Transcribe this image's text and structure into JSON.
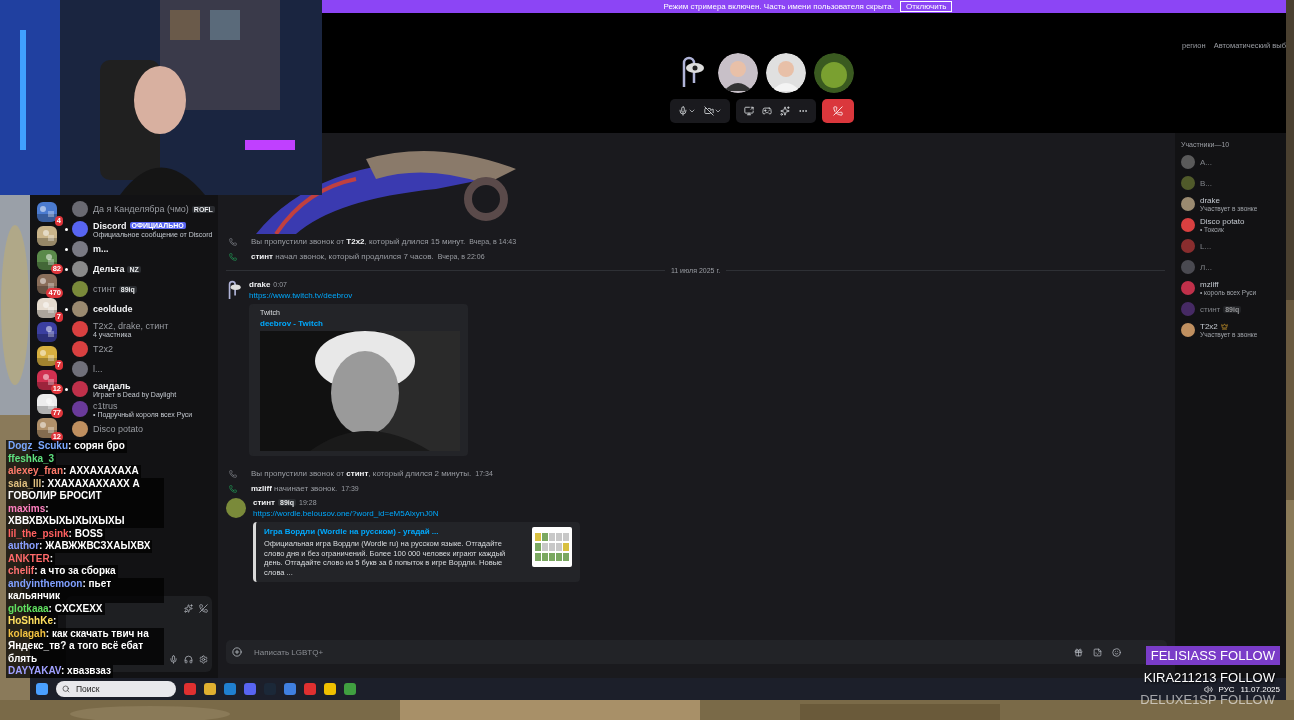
{
  "webcam": {
    "kind": "picture"
  },
  "banner": {
    "text": "Режим стримера включен. Часть имени пользователя скрыта.",
    "button": "Отключить"
  },
  "servers": [
    {
      "kind": "picture",
      "badge": "4"
    },
    {
      "kind": "picture"
    },
    {
      "kind": "picture",
      "badge": "82"
    },
    {
      "kind": "picture",
      "badge": "470"
    },
    {
      "kind": "picture",
      "badge": "7"
    },
    {
      "kind": "picture"
    },
    {
      "kind": "picture",
      "badge": "7"
    },
    {
      "kind": "picture",
      "badge": "12"
    },
    {
      "kind": "picture",
      "badge": "77"
    },
    {
      "kind": "picture",
      "badge": "12"
    }
  ],
  "dms": [
    {
      "name": "Да я Канделябра (чмо)",
      "tag": "ROFL",
      "unread": false
    },
    {
      "name": "Discord",
      "verified": "ОФИЦИАЛЬНО",
      "sub": "Официальное сообщение от Discord",
      "unread": true
    },
    {
      "name": "m...",
      "unread": true
    },
    {
      "name": "Дельта",
      "tag": "NZ",
      "unread": true
    },
    {
      "name": "стинт",
      "tag": "89iq",
      "unread": false
    },
    {
      "name": "ceoldude",
      "unread": true
    },
    {
      "name": "T2x2, drake, стинт",
      "sub": "4 участника",
      "unread": false
    },
    {
      "name": "T2x2",
      "unread": false
    },
    {
      "name": "l...",
      "unread": false
    },
    {
      "name": "сандаль",
      "sub": "Играет в Dead by Daylight",
      "unread": true
    },
    {
      "name": "c1trus",
      "sub": "• Подручный короля всех Руси",
      "unread": false
    },
    {
      "name": "Disco potato",
      "unread": false
    }
  ],
  "call": {
    "avatars": [
      {
        "kind": "clip"
      },
      {
        "kind": "person"
      },
      {
        "kind": "person"
      },
      {
        "kind": "character"
      }
    ],
    "region_label": "регион",
    "region_value": "Автоматический выб"
  },
  "messages": [
    {
      "kind": "picture"
    },
    {
      "kind": "call",
      "missed": true,
      "text": "Вы пропустили звонок от **T2x2**, который длился 15 минут.",
      "time": "Вчера, в 14:43"
    },
    {
      "kind": "call",
      "missed": false,
      "text": "**стинт** начал звонок, который продлился 7 часов.",
      "time": "Вчера, в 22:06"
    },
    {
      "kind": "divider",
      "text": "11 июля 2025 г."
    },
    {
      "kind": "message",
      "author": "drake",
      "avatar": {
        "kind": "clip"
      },
      "time": "0:07",
      "link": "https://www.twitch.tv/deebrov",
      "embed": {
        "provider": "Twitch",
        "title": "deebrov - Twitch"
      }
    },
    {
      "kind": "call",
      "missed": true,
      "text": "Вы пропустили звонок от **стинт**, который длился 2 минуты.",
      "time": "17:34"
    },
    {
      "kind": "call",
      "missed": false,
      "text": "**mzliff** начинает звонок.",
      "time": "17:39"
    },
    {
      "kind": "message",
      "author": "стинт",
      "tag": "89iq",
      "avatar": {
        "kind": "plain"
      },
      "time": "19:28",
      "link": "https://wordle.belousov.one/?word_id=eM5AlxynJ0N",
      "embed": {
        "kind": "thumb",
        "title": "Игра Вордли (Wordle на русском) - угадай ...",
        "description": "Официальная игра Вордли (Wordle ru) на русском языке. Отгадайте слово дня и без ограничений. Более 100 000 человек играют каждый день. Отгадайте слово из 5 букв за 6 попыток в игре Вордли. Новые слова ..."
      }
    }
  ],
  "composer": {
    "placeholder": "Написать LGBTQ+"
  },
  "members": {
    "title": "Участники—10",
    "items": [
      {
        "name": "А...",
        "offline": true
      },
      {
        "name": "В...",
        "offline": true
      },
      {
        "name": "drake",
        "sub": "Участвует в звонке",
        "offline": false
      },
      {
        "name": "Disco potato",
        "sub": "• Токсик",
        "offline": false
      },
      {
        "name": "L...",
        "offline": true
      },
      {
        "name": "Л...",
        "offline": true
      },
      {
        "name": "mzliff",
        "sub": "• король всех Руси",
        "offline": false
      },
      {
        "name": "стинт",
        "tag": "89iq",
        "offline": true
      },
      {
        "name": "T2x2",
        "owner": true,
        "sub": "Участвует в звонке",
        "offline": false
      }
    ]
  },
  "stream_chat": [
    {
      "user": "Dogz_Scuku",
      "separator": ":",
      "color": "#7aa8ff",
      "text": "сорян бро"
    },
    {
      "user": "ffeshka_3",
      "color": "#5fe07f"
    },
    {
      "user": "alexey_fran",
      "separator": ":",
      "color": "#ff7a6a",
      "text": "АХХАХАХАХА"
    },
    {
      "user": "saia_lll",
      "separator": ":",
      "color": "#e0c080",
      "text": "ХХАХАХАХХАХХ А ГОВОЛИР БРОСИТ"
    },
    {
      "user": "maxims",
      "separator": ":",
      "color": "#ff80c0",
      "text": "ХВВХВХЫХЫХЫХЫХЫ"
    },
    {
      "user": "lil_the_psink",
      "separator": ":",
      "color": "#ff6060",
      "text": "BOSS"
    },
    {
      "user": "author",
      "separator": ":",
      "color": "#8aa0ff",
      "text": "ЖАВЖЖВСЗХАЫХВХ"
    },
    {
      "user": "ANKTER",
      "separator": ":",
      "color": "#ff6a6a"
    },
    {
      "user": "chelif",
      "separator": ":",
      "color": "#ff7070",
      "text": "а что за сборка"
    },
    {
      "user": "andyinthemoon",
      "separator": ":",
      "color": "#80a0ff",
      "text": "пьет кальянчик"
    },
    {
      "user": "glotkaaa",
      "separator": ":",
      "color": "#60e060",
      "text": "CXCXEXX"
    },
    {
      "user": "HoShhKe",
      "separator": ":",
      "color": "#ffe060"
    },
    {
      "user": "kolagah",
      "separator": ":",
      "color": "#f0c040",
      "text": "как скачать твич на Яндекс_тв? а того всё ебат блять"
    },
    {
      "user": "DAYYAKAV",
      "separator": ":",
      "color": "#a0a0ff",
      "text": "хвазвзаз"
    }
  ],
  "taskbar": {
    "search": {
      "placeholder": "Поиск"
    },
    "lang": "РУС",
    "date": "11.07.2025"
  },
  "follows": [
    {
      "text": "FELISIASS FOLLOW",
      "kind": "active"
    },
    {
      "text": "KIRA211213 FOLLOW",
      "kind": "plain"
    },
    {
      "text": "DELUXE1SP FOLLOW",
      "kind": "fading"
    }
  ]
}
